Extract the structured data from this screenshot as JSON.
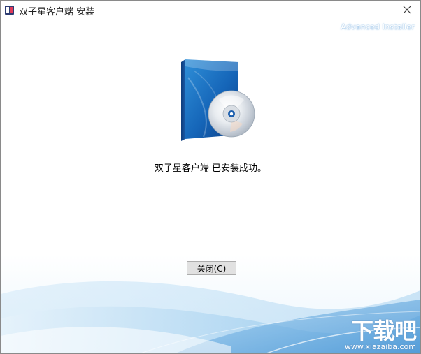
{
  "window": {
    "title": "双子星客户端 安装",
    "close_icon": "close-icon",
    "app_icon": "app-icon"
  },
  "branding": {
    "text": "Advanced Installer"
  },
  "main": {
    "product_icon": "software-box-cd-icon",
    "message": "双子星客户端 已安装成功。"
  },
  "footer": {
    "close_button_label": "关闭(C)"
  },
  "watermark": {
    "main": "下载吧",
    "url": "www.xiazaiba.com"
  },
  "colors": {
    "title_text": "#1f1f1f",
    "button_face": "#e1e1e1",
    "button_border": "#adadad",
    "wave_light": "#d8ecf9",
    "wave_mid": "#8ec4ec",
    "wave_dark": "#4e9ad8"
  }
}
